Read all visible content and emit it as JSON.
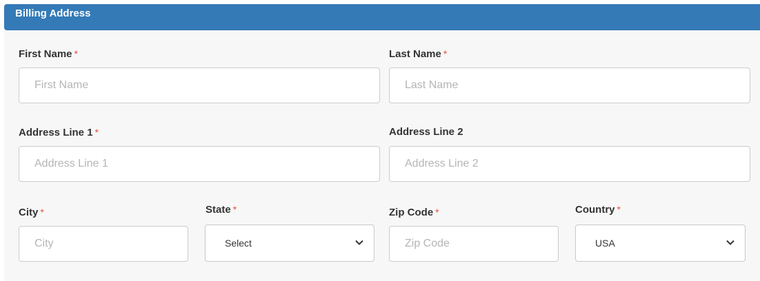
{
  "panel": {
    "title": "Billing Address"
  },
  "fields": {
    "first_name": {
      "label": "First Name",
      "required_mark": "*",
      "placeholder": "First Name",
      "value": ""
    },
    "last_name": {
      "label": "Last Name",
      "required_mark": "*",
      "placeholder": "Last Name",
      "value": ""
    },
    "address_line_1": {
      "label": "Address Line 1",
      "required_mark": "*",
      "placeholder": "Address Line 1",
      "value": ""
    },
    "address_line_2": {
      "label": "Address Line 2",
      "placeholder": "Address Line 2",
      "value": ""
    },
    "city": {
      "label": "City",
      "required_mark": "*",
      "placeholder": "City",
      "value": ""
    },
    "state": {
      "label": "State",
      "required_mark": "*",
      "selected": "Select",
      "icon": "chevron-down-icon"
    },
    "zip_code": {
      "label": "Zip Code",
      "required_mark": "*",
      "placeholder": "Zip Code",
      "value": ""
    },
    "country": {
      "label": "Country",
      "required_mark": "*",
      "selected": "USA",
      "icon": "chevron-down-icon"
    }
  },
  "colors": {
    "header_bg": "#337ab7",
    "required": "#e74c3c",
    "panel_bg": "#f7f7f7"
  }
}
